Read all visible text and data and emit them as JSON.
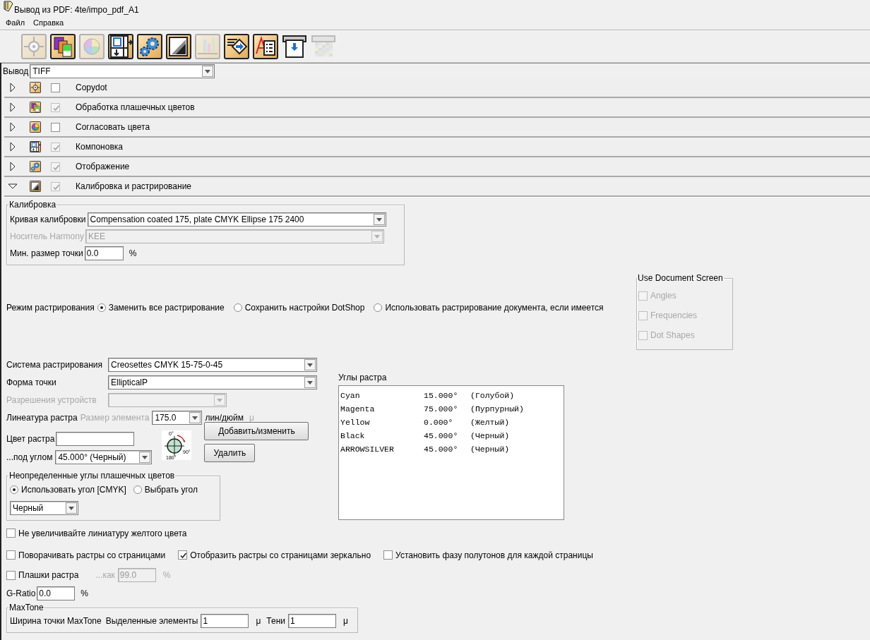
{
  "window": {
    "title": "Вывод из PDF: 4te/impo_pdf_A1"
  },
  "menu": [
    "Файл",
    "Справка"
  ],
  "toolbar": [
    {
      "kind": "target",
      "disabled": true
    },
    {
      "kind": "swatches",
      "disabled": false
    },
    {
      "kind": "colorwheel",
      "disabled": true
    },
    {
      "kind": "layout",
      "disabled": false
    },
    {
      "kind": "gears",
      "disabled": false
    },
    {
      "kind": "gradient",
      "disabled": false
    },
    {
      "kind": "chart",
      "disabled": true
    },
    {
      "kind": "arrowdoc",
      "disabled": false
    },
    {
      "kind": "doclist",
      "disabled": false
    },
    {
      "kind": "printer",
      "disabled": false
    },
    {
      "kind": "palette",
      "disabled": true
    }
  ],
  "output": {
    "label": "Вывод",
    "value": "TIFF"
  },
  "sections": [
    {
      "kind": "target",
      "label": "Copydot",
      "checked": false,
      "expanded": false
    },
    {
      "kind": "swatches",
      "label": "Обработка плашечных цветов",
      "checked": true,
      "expanded": false
    },
    {
      "kind": "colorwheel",
      "label": "Согласовать цвета",
      "checked": false,
      "expanded": false
    },
    {
      "kind": "layout",
      "label": "Компоновка",
      "checked": true,
      "expanded": false
    },
    {
      "kind": "gears",
      "label": "Отображение",
      "checked": true,
      "expanded": false
    },
    {
      "kind": "gradient",
      "label": "Калибровка и растрирование",
      "checked": true,
      "expanded": true
    }
  ],
  "calibration": {
    "title": "Калибровка",
    "curve": {
      "label": "Кривая калибровки",
      "value": "Compensation coated 175, plate CMYK Ellipse 175 2400",
      "disabled": false
    },
    "media": {
      "label": "Носитель Harmony",
      "value": "KEE",
      "disabled": true
    },
    "min_dot": {
      "label": "Мин. размер точки",
      "value": "0.0",
      "unit": "%"
    }
  },
  "screening_mode": {
    "label": "Режим растрирования",
    "options": [
      {
        "label": "Заменить все растрирование",
        "selected": true
      },
      {
        "label": "Сохранить настройки DotShop",
        "selected": false
      },
      {
        "label": "Использовать растрирование документа, если имеется",
        "selected": false
      }
    ]
  },
  "use_document_screen": {
    "title": "Use Document Screen",
    "options": [
      {
        "label": "Angles",
        "checked": false,
        "disabled": true
      },
      {
        "label": "Frequencies",
        "checked": false,
        "disabled": true
      },
      {
        "label": "Dot Shapes",
        "checked": false,
        "disabled": true
      }
    ]
  },
  "screen_system": {
    "label": "Система растрирования",
    "value": "Creosettes CMYK 15-75-0-45"
  },
  "dot_shape": {
    "label": "Форма точки",
    "value": "EllipticalP"
  },
  "device_resolution": {
    "label": "Разрешения устройств",
    "disabled": true
  },
  "ruling": {
    "label": "Линеатура растра",
    "element_size_label": "Размер элемента",
    "value": "175.0",
    "unit": "лин/дюйм",
    "micro_unit": "μ"
  },
  "screen_color": {
    "label": "Цвет растра"
  },
  "angle": {
    "label": "...под углом",
    "value": "45.000° (Черный)"
  },
  "angle_dial": {
    "labels": [
      "0°",
      "90°",
      "180°"
    ]
  },
  "buttons": [
    "Добавить/изменить",
    "Удалить"
  ],
  "screen_angles": {
    "title": "Углы растра",
    "rows": [
      {
        "name": "Cyan",
        "angle": "15.000°",
        "color_name": "(Голубой)"
      },
      {
        "name": "Magenta",
        "angle": "75.000°",
        "color_name": "(Пурпурный)"
      },
      {
        "name": "Yellow",
        "angle": "0.000°",
        "color_name": "(Желтый)"
      },
      {
        "name": "Black",
        "angle": "45.000°",
        "color_name": "(Черный)"
      },
      {
        "name": "ARROWSILVER",
        "angle": "45.000°",
        "color_name": "(Черный)"
      }
    ]
  },
  "spot_angles": {
    "title": "Неопределенные углы плашечных цветов",
    "options": [
      {
        "label": "Использовать угол [CMYK]",
        "selected": true
      },
      {
        "label": "Выбрать угол",
        "selected": false
      }
    ],
    "value": "Черный"
  },
  "option_rows": [
    [
      {
        "label": "Не увеличивайте линиатуру желтого цвета",
        "checked": false
      }
    ],
    [
      {
        "label": "Поворачивать растры со страницами",
        "checked": false
      },
      {
        "label": "Отобразить растры со страницами зеркально",
        "checked": true
      },
      {
        "label": "Установить фазу полутонов для каждой страницы",
        "checked": false
      }
    ]
  ],
  "screen_tints": {
    "label": "Плашки растра",
    "checked": false,
    "as_label": "...как",
    "value": "99.0",
    "unit": "%"
  },
  "g_ratio": {
    "label": "G-Ratio",
    "value": "0.0",
    "unit": "%"
  },
  "maxtone": {
    "title": "MaxTone",
    "label": "Ширина точки MaxTone",
    "fields": [
      {
        "label": "Выделенные элементы",
        "value": "1",
        "unit": "μ"
      },
      {
        "label": "Тени",
        "value": "1",
        "unit": "μ"
      }
    ]
  }
}
